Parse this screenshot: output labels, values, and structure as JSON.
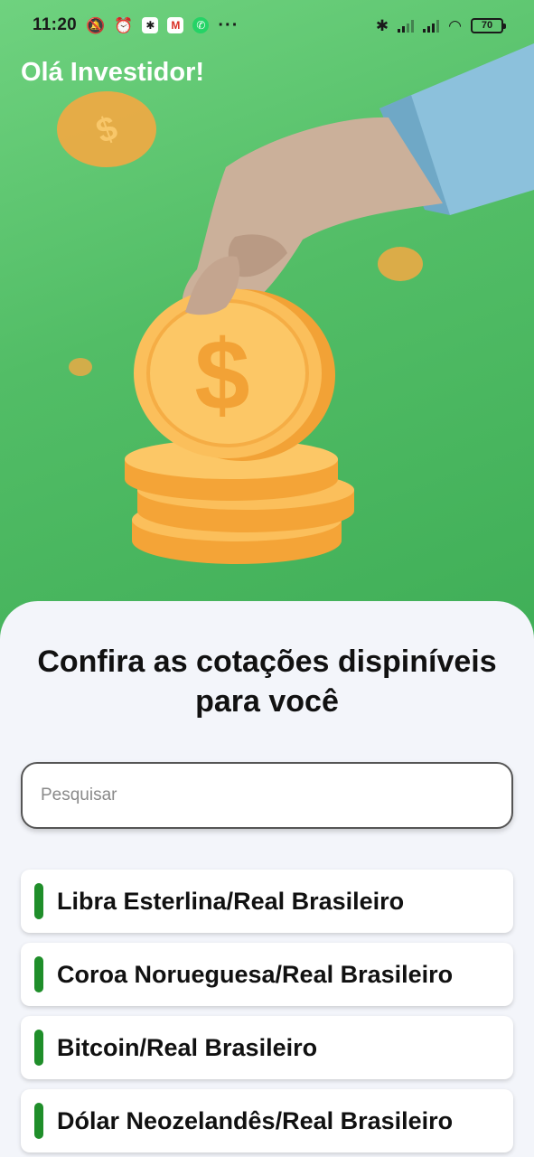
{
  "status_bar": {
    "time": "11:20",
    "battery": "70",
    "icons": [
      "notifications-off-icon",
      "alarm-icon",
      "app-icon",
      "gmail-icon",
      "whatsapp-icon",
      "more-icon",
      "bluetooth-icon",
      "signal-icon",
      "signal-icon",
      "wifi-icon",
      "battery-icon"
    ]
  },
  "header": {
    "greeting": "Olá Investidor!"
  },
  "main": {
    "headline": "Confira as cotações dispiníveis para você",
    "search": {
      "placeholder": "Pesquisar",
      "value": ""
    },
    "quotes": [
      {
        "label": "Libra Esterlina/Real Brasileiro"
      },
      {
        "label": "Coroa Norueguesa/Real Brasileiro"
      },
      {
        "label": "Bitcoin/Real Brasileiro"
      },
      {
        "label": "Dólar Neozelandês/Real Brasileiro"
      }
    ]
  },
  "colors": {
    "hero_green": "#52bd66",
    "accent_bar": "#1f8e2a",
    "coin_gold": "#f7b84b"
  }
}
